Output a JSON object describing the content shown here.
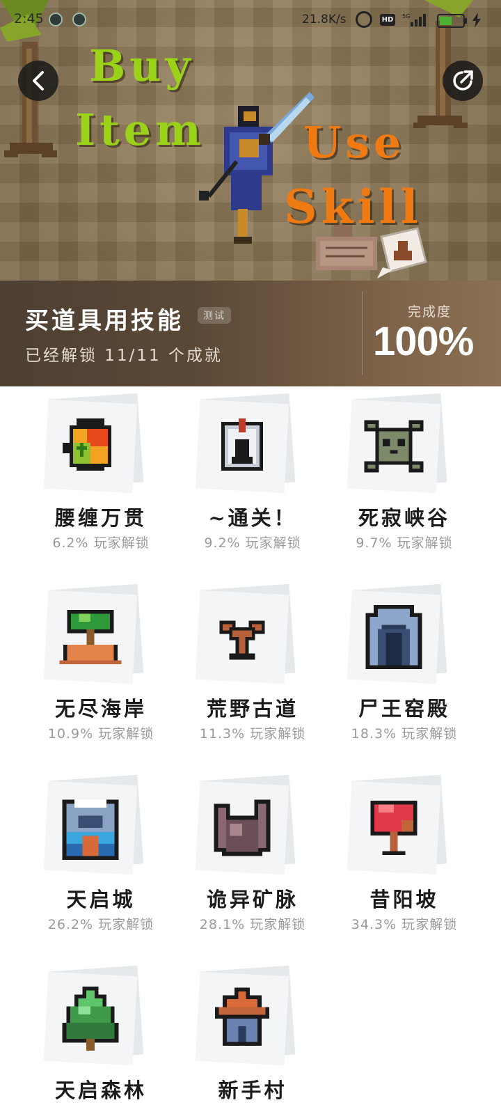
{
  "status_bar": {
    "time": "2:45",
    "net_speed": "21.8K/s",
    "hd_label": "HD",
    "network_type": "5G",
    "battery_level": 0.54
  },
  "hero": {
    "headline_buy": "Buy",
    "headline_item": "Item",
    "headline_use": "Use",
    "headline_skill": "Skill"
  },
  "game": {
    "title": "买道具用技能",
    "badge": "测试",
    "unlock_status": "已经解锁 11/11 个成就",
    "completion_label": "完成度",
    "completion_value": "100%"
  },
  "achievements": [
    {
      "name": "腰缠万贯",
      "percent": "6.2% 玩家解锁",
      "icon": "money-pouch-icon"
    },
    {
      "name": "~通关！",
      "percent": "9.2% 玩家解锁",
      "icon": "knight-helmet-icon"
    },
    {
      "name": "死寂峡谷",
      "percent": "9.7% 玩家解锁",
      "icon": "skull-crossbones-icon"
    },
    {
      "name": "无尽海岸",
      "percent": "10.9% 玩家解锁",
      "icon": "palm-island-icon"
    },
    {
      "name": "荒野古道",
      "percent": "11.3% 玩家解锁",
      "icon": "dead-tree-icon"
    },
    {
      "name": "尸王窑殿",
      "percent": "18.3% 玩家解锁",
      "icon": "stone-archway-icon"
    },
    {
      "name": "天启城",
      "percent": "26.2% 玩家解锁",
      "icon": "castle-gate-icon"
    },
    {
      "name": "诡异矿脉",
      "percent": "28.1% 玩家解锁",
      "icon": "rock-crystal-icon"
    },
    {
      "name": "昔阳坡",
      "percent": "34.3% 玩家解锁",
      "icon": "red-tree-icon"
    },
    {
      "name": "天启森林",
      "percent": "",
      "icon": "pine-tree-icon"
    },
    {
      "name": "新手村",
      "percent": "",
      "icon": "hut-icon"
    }
  ],
  "colors": {
    "headline_green": "#9ad21a",
    "headline_orange": "#f07a12",
    "name_text": "#1c1c1c",
    "percent_text": "#9a9a9a"
  }
}
